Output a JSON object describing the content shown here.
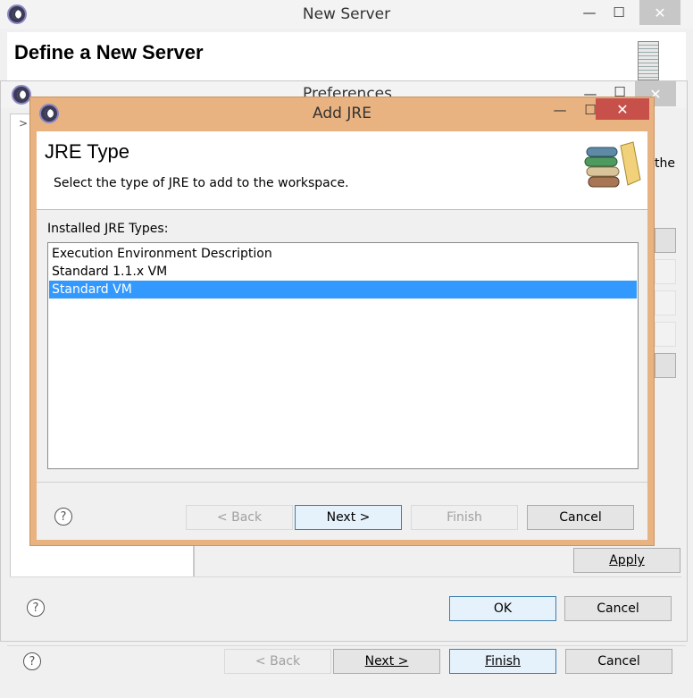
{
  "new_server": {
    "title": "New Server",
    "banner_title": "Define a New Server",
    "back": "< Back",
    "next": "Next >",
    "finish": "Finish",
    "cancel": "Cancel"
  },
  "preferences": {
    "title": "Preferences",
    "tree_arrow": ">",
    "side_text": "the",
    "apply": "Apply",
    "ok": "OK",
    "cancel": "Cancel"
  },
  "add_jre": {
    "title": "Add JRE",
    "heading": "JRE Type",
    "description": "Select the type of JRE to add to the workspace.",
    "list_label": "Installed JRE Types:",
    "items": [
      "Execution Environment Description",
      "Standard 1.1.x VM",
      "Standard VM"
    ],
    "selected_index": 2,
    "back": "< Back",
    "next": "Next >",
    "finish": "Finish",
    "cancel": "Cancel"
  },
  "window_controls": {
    "minimize": "—",
    "maximize": "☐",
    "close": "✕"
  },
  "help_glyph": "?",
  "colors": {
    "dialog_frame": "#e9b281",
    "close_active": "#c7514a",
    "selection": "#3399ff",
    "primary_border": "#3c7fb1"
  }
}
